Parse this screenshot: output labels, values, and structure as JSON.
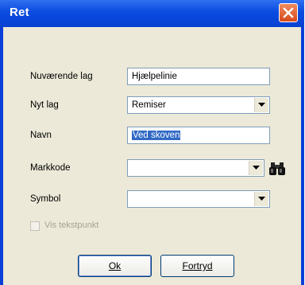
{
  "window": {
    "title": "Ret"
  },
  "fields": {
    "current_layer_label": "Nuværende lag",
    "current_layer_value": "Hjælpelinie",
    "new_layer_label": "Nyt lag",
    "new_layer_value": "Remiser",
    "name_label": "Navn",
    "name_value": "Ved skoven",
    "field_code_label": "Markkode",
    "field_code_value": "",
    "symbol_label": "Symbol",
    "symbol_value": ""
  },
  "checkbox": {
    "label": "Vis tekstpunkt",
    "checked": false,
    "enabled": false
  },
  "buttons": {
    "ok_label": "Ok",
    "cancel_label": "Fortryd"
  },
  "icons": {
    "close": "close-icon",
    "search": "binoculars-icon"
  },
  "colors": {
    "titlebar": "#0a4be0",
    "close": "#d8491c",
    "dialog_bg": "#ece9d8",
    "selection": "#316ac5"
  }
}
